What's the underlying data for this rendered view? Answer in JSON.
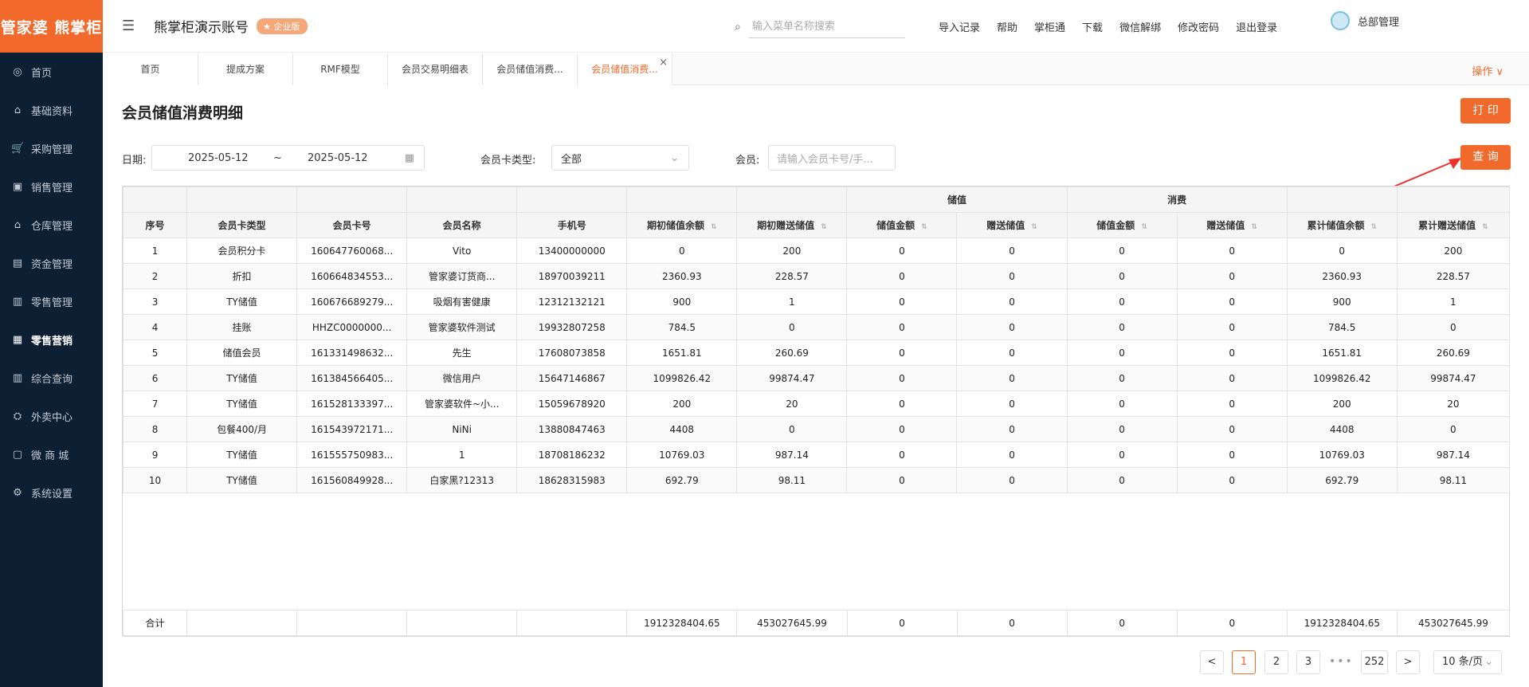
{
  "sidebar": {
    "logo": "管家婆 熊掌柜",
    "items": [
      {
        "label": "首页",
        "icon": "globe-icon",
        "glyph": "◎"
      },
      {
        "label": "基础资料",
        "icon": "home-icon",
        "glyph": "⌂"
      },
      {
        "label": "采购管理",
        "icon": "cart-icon",
        "glyph": "🛒"
      },
      {
        "label": "销售管理",
        "icon": "sales-icon",
        "glyph": "▣"
      },
      {
        "label": "仓库管理",
        "icon": "warehouse-icon",
        "glyph": "⌂"
      },
      {
        "label": "资金管理",
        "icon": "money-icon",
        "glyph": "▤"
      },
      {
        "label": "零售管理",
        "icon": "chart-icon",
        "glyph": "▥"
      },
      {
        "label": "零售营销",
        "icon": "gift-icon",
        "glyph": "▦"
      },
      {
        "label": "综合查询",
        "icon": "bar-chart-icon",
        "glyph": "▥"
      },
      {
        "label": "外卖中心",
        "icon": "delivery-icon",
        "glyph": "⛭"
      },
      {
        "label": "微 商 城",
        "icon": "shop-icon",
        "glyph": "▢"
      },
      {
        "label": "系统设置",
        "icon": "gear-icon",
        "glyph": "⚙"
      }
    ]
  },
  "header": {
    "account": "熊掌柜演示账号",
    "edition": "企业版",
    "search_placeholder": "输入菜单名称搜索",
    "links": [
      "导入记录",
      "帮助",
      "掌柜通",
      "下载",
      "微信解绑",
      "修改密码",
      "退出登录"
    ],
    "user": "总部管理"
  },
  "tabs": [
    "首页",
    "提成方案",
    "RMF模型",
    "会员交易明细表",
    "会员储值消费...",
    "会员储值消费..."
  ],
  "ops_label": "操作 ∨",
  "page": {
    "title": "会员储值消费明细",
    "print_label": "打 印",
    "query_label": "查 询"
  },
  "filters": {
    "date_label": "日期:",
    "date_start": "2025-05-12",
    "date_sep": "~",
    "date_end": "2025-05-12",
    "card_type_label": "会员卡类型:",
    "card_type_value": "全部",
    "member_label": "会员:",
    "member_placeholder": "请输入会员卡号/手..."
  },
  "table": {
    "group_headers": {
      "deposit": "储值",
      "consume": "消费"
    },
    "columns": [
      "序号",
      "会员卡类型",
      "会员卡号",
      "会员名称",
      "手机号",
      "期初储值余额",
      "期初赠送储值",
      "储值金额",
      "赠送储值",
      "储值金额",
      "赠送储值",
      "累计储值余额",
      "累计赠送储值"
    ],
    "rows": [
      [
        "1",
        "会员积分卡",
        "160647760068...",
        "Vito",
        "13400000000",
        "0",
        "200",
        "0",
        "0",
        "0",
        "0",
        "0",
        "200"
      ],
      [
        "2",
        "折扣",
        "160664834553...",
        "管家婆订货商...",
        "18970039211",
        "2360.93",
        "228.57",
        "0",
        "0",
        "0",
        "0",
        "2360.93",
        "228.57"
      ],
      [
        "3",
        "TY储值",
        "160676689279...",
        "吸烟有害健康",
        "12312132121",
        "900",
        "1",
        "0",
        "0",
        "0",
        "0",
        "900",
        "1"
      ],
      [
        "4",
        "挂账",
        "HHZC0000000...",
        "管家婆软件测试",
        "19932807258",
        "784.5",
        "0",
        "0",
        "0",
        "0",
        "0",
        "784.5",
        "0"
      ],
      [
        "5",
        "储值会员",
        "161331498632...",
        "先生",
        "17608073858",
        "1651.81",
        "260.69",
        "0",
        "0",
        "0",
        "0",
        "1651.81",
        "260.69"
      ],
      [
        "6",
        "TY储值",
        "161384566405...",
        "微信用户",
        "15647146867",
        "1099826.42",
        "99874.47",
        "0",
        "0",
        "0",
        "0",
        "1099826.42",
        "99874.47"
      ],
      [
        "7",
        "TY储值",
        "161528133397...",
        "管家婆软件~小...",
        "15059678920",
        "200",
        "20",
        "0",
        "0",
        "0",
        "0",
        "200",
        "20"
      ],
      [
        "8",
        "包餐400/月",
        "161543972171...",
        "NiNi",
        "13880847463",
        "4408",
        "0",
        "0",
        "0",
        "0",
        "0",
        "4408",
        "0"
      ],
      [
        "9",
        "TY储值",
        "161555750983...",
        "1",
        "18708186232",
        "10769.03",
        "987.14",
        "0",
        "0",
        "0",
        "0",
        "10769.03",
        "987.14"
      ],
      [
        "10",
        "TY储值",
        "161560849928...",
        "白家黑?12313",
        "18628315983",
        "692.79",
        "98.11",
        "0",
        "0",
        "0",
        "0",
        "692.79",
        "98.11"
      ]
    ],
    "totals": [
      "合计",
      "",
      "",
      "",
      "",
      "1912328404.65",
      "453027645.99",
      "0",
      "0",
      "0",
      "0",
      "1912328404.65",
      "453027645.99"
    ]
  },
  "pagination": {
    "prev": "<",
    "pages": [
      "1",
      "2",
      "3"
    ],
    "ellipsis": "•••",
    "last": "252",
    "next": ">",
    "page_size": "10 条/页",
    "current": "1"
  }
}
